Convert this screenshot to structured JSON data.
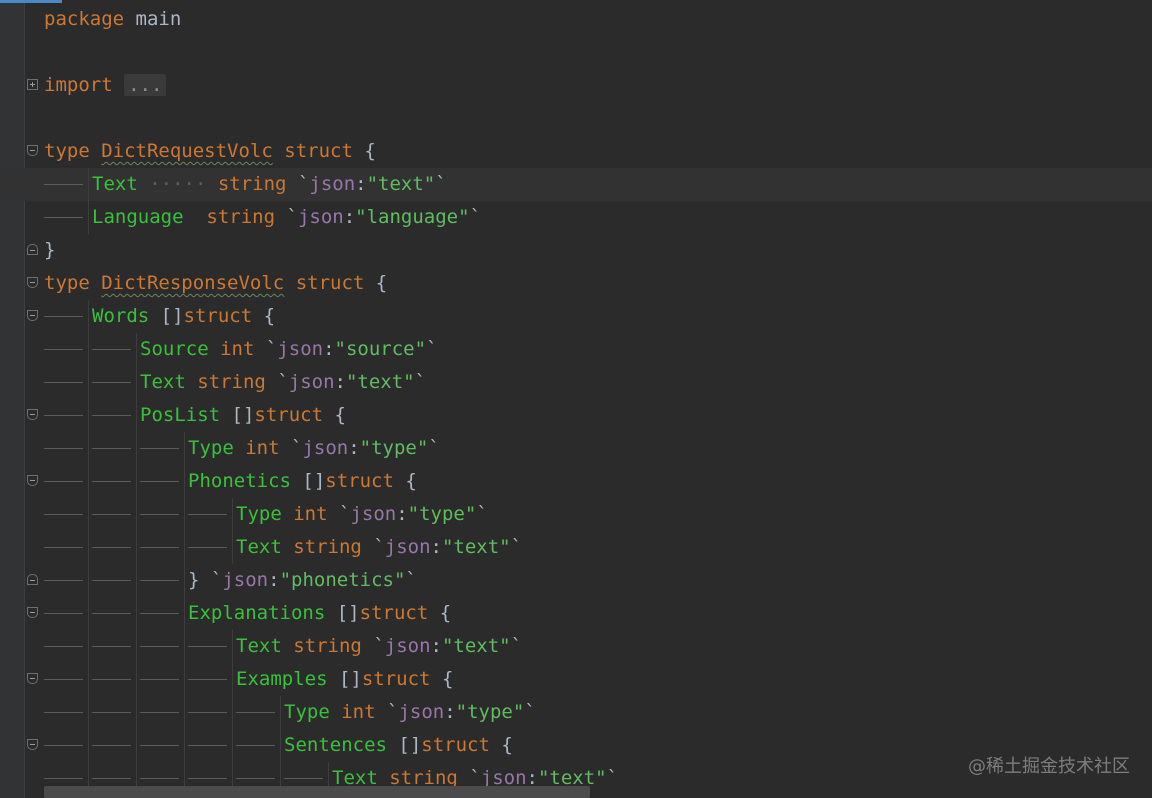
{
  "editor": {
    "lines": [
      {
        "fold": "none",
        "caret": false,
        "indent": 0,
        "tokens": [
          [
            "kw",
            "package"
          ],
          [
            "sp",
            " "
          ],
          [
            "name",
            "main"
          ]
        ]
      },
      {
        "fold": "none",
        "caret": false,
        "indent": 0,
        "tokens": []
      },
      {
        "fold": "collapsed",
        "caret": false,
        "indent": 0,
        "tokens": [
          [
            "kw",
            "import"
          ],
          [
            "sp",
            " "
          ],
          [
            "ph",
            "..."
          ]
        ]
      },
      {
        "fold": "none",
        "caret": false,
        "indent": 0,
        "tokens": []
      },
      {
        "fold": "open",
        "caret": false,
        "indent": 0,
        "tokens": [
          [
            "kw",
            "type"
          ],
          [
            "sp",
            " "
          ],
          [
            "tn",
            "DictRequestVolc"
          ],
          [
            "sp",
            " "
          ],
          [
            "kw",
            "struct"
          ],
          [
            "sp",
            " "
          ],
          [
            "br",
            "{"
          ]
        ]
      },
      {
        "fold": "none",
        "caret": true,
        "indent": 1,
        "tokens": [
          [
            "fd",
            "Text"
          ],
          [
            "dots",
            " ····· "
          ],
          [
            "ty",
            "string"
          ],
          [
            "sp",
            " "
          ],
          [
            "tk",
            "`"
          ],
          [
            "tg",
            "json"
          ],
          [
            "co",
            ":"
          ],
          [
            "tv",
            "\"text\""
          ],
          [
            "tk",
            "`"
          ]
        ]
      },
      {
        "fold": "none",
        "caret": false,
        "indent": 1,
        "tokens": [
          [
            "fd",
            "Language"
          ],
          [
            "sp",
            "  "
          ],
          [
            "ty",
            "string"
          ],
          [
            "sp",
            " "
          ],
          [
            "tk",
            "`"
          ],
          [
            "tg",
            "json"
          ],
          [
            "co",
            ":"
          ],
          [
            "tv",
            "\"language\""
          ],
          [
            "tk",
            "`"
          ]
        ]
      },
      {
        "fold": "end",
        "caret": false,
        "indent": 0,
        "tokens": [
          [
            "br",
            "}"
          ]
        ]
      },
      {
        "fold": "open",
        "caret": false,
        "indent": 0,
        "tokens": [
          [
            "kw",
            "type"
          ],
          [
            "sp",
            " "
          ],
          [
            "tn",
            "DictResponseVolc"
          ],
          [
            "sp",
            " "
          ],
          [
            "kw",
            "struct"
          ],
          [
            "sp",
            " "
          ],
          [
            "br",
            "{"
          ]
        ]
      },
      {
        "fold": "open",
        "caret": false,
        "indent": 1,
        "tokens": [
          [
            "fd",
            "Words"
          ],
          [
            "sp",
            " "
          ],
          [
            "br",
            "[]"
          ],
          [
            "kw",
            "struct"
          ],
          [
            "sp",
            " "
          ],
          [
            "br",
            "{"
          ]
        ]
      },
      {
        "fold": "none",
        "caret": false,
        "indent": 2,
        "tokens": [
          [
            "fd",
            "Source"
          ],
          [
            "sp",
            " "
          ],
          [
            "ty",
            "int"
          ],
          [
            "sp",
            " "
          ],
          [
            "tk",
            "`"
          ],
          [
            "tg",
            "json"
          ],
          [
            "co",
            ":"
          ],
          [
            "tv",
            "\"source\""
          ],
          [
            "tk",
            "`"
          ]
        ]
      },
      {
        "fold": "none",
        "caret": false,
        "indent": 2,
        "tokens": [
          [
            "fd",
            "Text"
          ],
          [
            "sp",
            " "
          ],
          [
            "ty",
            "string"
          ],
          [
            "sp",
            " "
          ],
          [
            "tk",
            "`"
          ],
          [
            "tg",
            "json"
          ],
          [
            "co",
            ":"
          ],
          [
            "tv",
            "\"text\""
          ],
          [
            "tk",
            "`"
          ]
        ]
      },
      {
        "fold": "open",
        "caret": false,
        "indent": 2,
        "tokens": [
          [
            "fd",
            "PosList"
          ],
          [
            "sp",
            " "
          ],
          [
            "br",
            "[]"
          ],
          [
            "kw",
            "struct"
          ],
          [
            "sp",
            " "
          ],
          [
            "br",
            "{"
          ]
        ]
      },
      {
        "fold": "none",
        "caret": false,
        "indent": 3,
        "tokens": [
          [
            "fd",
            "Type"
          ],
          [
            "sp",
            " "
          ],
          [
            "ty",
            "int"
          ],
          [
            "sp",
            " "
          ],
          [
            "tk",
            "`"
          ],
          [
            "tg",
            "json"
          ],
          [
            "co",
            ":"
          ],
          [
            "tv",
            "\"type\""
          ],
          [
            "tk",
            "`"
          ]
        ]
      },
      {
        "fold": "open",
        "caret": false,
        "indent": 3,
        "tokens": [
          [
            "fd",
            "Phonetics"
          ],
          [
            "sp",
            " "
          ],
          [
            "br",
            "[]"
          ],
          [
            "kw",
            "struct"
          ],
          [
            "sp",
            " "
          ],
          [
            "br",
            "{"
          ]
        ]
      },
      {
        "fold": "none",
        "caret": false,
        "indent": 4,
        "tokens": [
          [
            "fd",
            "Type"
          ],
          [
            "sp",
            " "
          ],
          [
            "ty",
            "int"
          ],
          [
            "sp",
            " "
          ],
          [
            "tk",
            "`"
          ],
          [
            "tg",
            "json"
          ],
          [
            "co",
            ":"
          ],
          [
            "tv",
            "\"type\""
          ],
          [
            "tk",
            "`"
          ]
        ]
      },
      {
        "fold": "none",
        "caret": false,
        "indent": 4,
        "tokens": [
          [
            "fd",
            "Text"
          ],
          [
            "sp",
            " "
          ],
          [
            "ty",
            "string"
          ],
          [
            "sp",
            " "
          ],
          [
            "tk",
            "`"
          ],
          [
            "tg",
            "json"
          ],
          [
            "co",
            ":"
          ],
          [
            "tv",
            "\"text\""
          ],
          [
            "tk",
            "`"
          ]
        ]
      },
      {
        "fold": "end",
        "caret": false,
        "indent": 3,
        "tokens": [
          [
            "br",
            "}"
          ],
          [
            "sp",
            " "
          ],
          [
            "tk",
            "`"
          ],
          [
            "tg",
            "json"
          ],
          [
            "co",
            ":"
          ],
          [
            "tv",
            "\"phonetics\""
          ],
          [
            "tk",
            "`"
          ]
        ]
      },
      {
        "fold": "open",
        "caret": false,
        "indent": 3,
        "tokens": [
          [
            "fd",
            "Explanations"
          ],
          [
            "sp",
            " "
          ],
          [
            "br",
            "[]"
          ],
          [
            "kw",
            "struct"
          ],
          [
            "sp",
            " "
          ],
          [
            "br",
            "{"
          ]
        ]
      },
      {
        "fold": "none",
        "caret": false,
        "indent": 4,
        "tokens": [
          [
            "fd",
            "Text"
          ],
          [
            "sp",
            " "
          ],
          [
            "ty",
            "string"
          ],
          [
            "sp",
            " "
          ],
          [
            "tk",
            "`"
          ],
          [
            "tg",
            "json"
          ],
          [
            "co",
            ":"
          ],
          [
            "tv",
            "\"text\""
          ],
          [
            "tk",
            "`"
          ]
        ]
      },
      {
        "fold": "open",
        "caret": false,
        "indent": 4,
        "tokens": [
          [
            "fd",
            "Examples"
          ],
          [
            "sp",
            " "
          ],
          [
            "br",
            "[]"
          ],
          [
            "kw",
            "struct"
          ],
          [
            "sp",
            " "
          ],
          [
            "br",
            "{"
          ]
        ]
      },
      {
        "fold": "none",
        "caret": false,
        "indent": 5,
        "tokens": [
          [
            "fd",
            "Type"
          ],
          [
            "sp",
            " "
          ],
          [
            "ty",
            "int"
          ],
          [
            "sp",
            " "
          ],
          [
            "tk",
            "`"
          ],
          [
            "tg",
            "json"
          ],
          [
            "co",
            ":"
          ],
          [
            "tv",
            "\"type\""
          ],
          [
            "tk",
            "`"
          ]
        ]
      },
      {
        "fold": "open",
        "caret": false,
        "indent": 5,
        "tokens": [
          [
            "fd",
            "Sentences"
          ],
          [
            "sp",
            " "
          ],
          [
            "br",
            "[]"
          ],
          [
            "kw",
            "struct"
          ],
          [
            "sp",
            " "
          ],
          [
            "br",
            "{"
          ]
        ]
      },
      {
        "fold": "none",
        "caret": false,
        "indent": 6,
        "tokens": [
          [
            "fd",
            "Text"
          ],
          [
            "sp",
            " "
          ],
          [
            "ty",
            "string"
          ],
          [
            "sp",
            " "
          ],
          [
            "tk",
            "`"
          ],
          [
            "tg",
            "json"
          ],
          [
            "co",
            ":"
          ],
          [
            "tv",
            "\"text\""
          ],
          [
            "tk",
            "`"
          ]
        ]
      }
    ]
  },
  "watermark": "@稀土掘金技术社区",
  "colors": {
    "background": "#2b2b2b",
    "keyword": "#cc7832",
    "field": "#39c13b",
    "tag_key": "#9876aa",
    "tag_value": "#5fbd5f",
    "plain": "#a9b7c6"
  }
}
